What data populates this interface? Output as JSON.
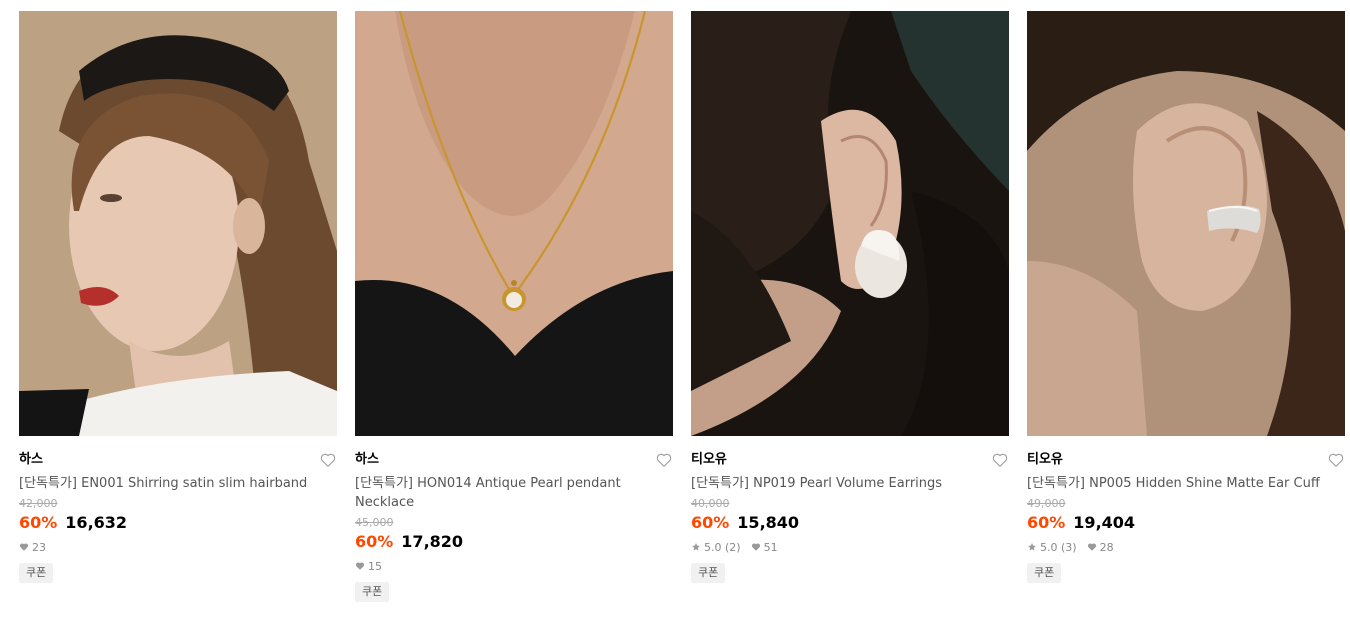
{
  "products": [
    {
      "brand": "하스",
      "title": "[단독특가] EN001 Shirring satin slim hairband",
      "original_price": "42,000",
      "discount": "60%",
      "price": "16,632",
      "rating": "",
      "likes": "23",
      "coupon": "쿠폰",
      "image": "woman-with-black-satin-hairband"
    },
    {
      "brand": "하스",
      "title": "[단독특가] HON014 Antique Pearl pendant Necklace",
      "original_price": "45,000",
      "discount": "60%",
      "price": "17,820",
      "rating": "",
      "likes": "15",
      "coupon": "쿠폰",
      "image": "gold-chain-pearl-pendant-necklace"
    },
    {
      "brand": "티오유",
      "title": "[단독특가] NP019 Pearl Volume Earrings",
      "original_price": "40,000",
      "discount": "60%",
      "price": "15,840",
      "rating": "5.0 (2)",
      "likes": "51",
      "coupon": "쿠폰",
      "image": "pearl-drop-earring-on-ear"
    },
    {
      "brand": "티오유",
      "title": "[단독특가] NP005 Hidden Shine Matte Ear Cuff",
      "original_price": "49,000",
      "discount": "60%",
      "price": "19,404",
      "rating": "5.0 (3)",
      "likes": "28",
      "coupon": "쿠폰",
      "image": "silver-matte-ear-cuff-on-ear"
    }
  ],
  "icons": {
    "wishlist": "heart-outline-icon",
    "likes": "heart-icon",
    "rating": "star-icon"
  },
  "colors": {
    "discount": "#ff4800",
    "price": "#000000",
    "original_price": "#aaaaaa",
    "coupon_bg": "#f1f1f1"
  }
}
